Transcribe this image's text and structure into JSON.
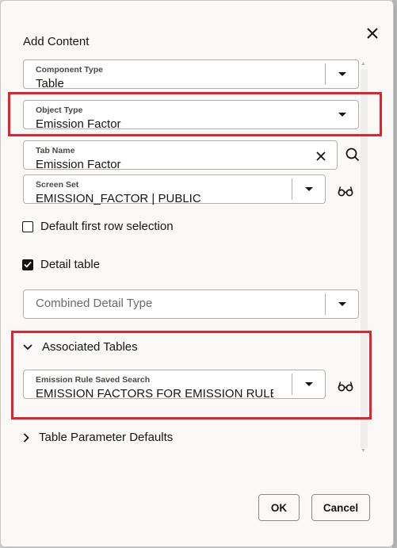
{
  "dialog": {
    "title": "Add Content"
  },
  "component_type": {
    "label": "Component Type",
    "value": "Table"
  },
  "object_type": {
    "label": "Object Type",
    "value": "Emission Factor"
  },
  "tab_name": {
    "label": "Tab Name",
    "value": "Emission Factor"
  },
  "screen_set": {
    "label": "Screen Set",
    "value": "EMISSION_FACTOR | PUBLIC"
  },
  "default_first_row": {
    "label": "Default first row selection",
    "checked": false
  },
  "detail_table": {
    "label": "Detail table",
    "checked": true
  },
  "combined_detail_type": {
    "placeholder": "Combined Detail Type",
    "value": ""
  },
  "associated_tables": {
    "label": "Associated Tables",
    "expanded": true,
    "emission_rule_saved_search": {
      "label": "Emission Rule Saved Search",
      "value": "EMISSION FACTORS FOR EMISSION RULE"
    }
  },
  "table_parameter_defaults": {
    "label": "Table Parameter Defaults",
    "expanded": false
  },
  "footer": {
    "ok_label": "OK",
    "cancel_label": "Cancel"
  },
  "colors": {
    "highlight": "#e0232f",
    "surface": "#fbf9f8",
    "border": "#b3afab",
    "text": "#161513"
  },
  "icons": [
    "close-icon",
    "chevron-down-icon",
    "clear-icon",
    "search-icon",
    "view-glasses-icon",
    "checkmark-icon",
    "chevron-right-icon"
  ]
}
